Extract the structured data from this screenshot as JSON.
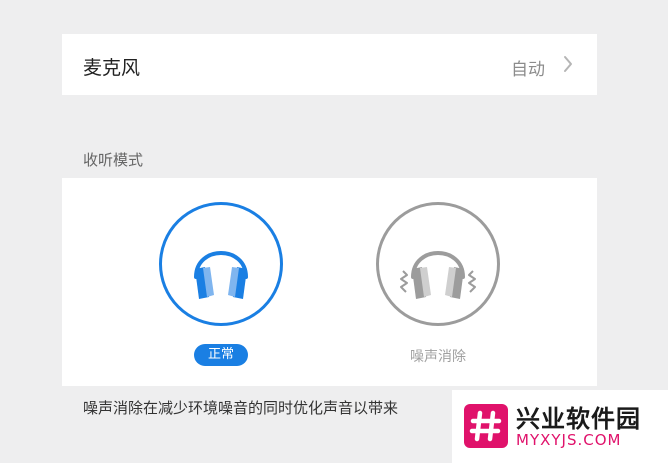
{
  "microphone": {
    "label": "麦克风",
    "value": "自动"
  },
  "listening_mode": {
    "title": "收听模式",
    "options": [
      {
        "label": "正常",
        "selected": true,
        "icon": "headphones-icon"
      },
      {
        "label": "噪声消除",
        "selected": false,
        "icon": "headphones-noise-icon"
      }
    ]
  },
  "description": "噪声消除在减少环境噪音的同时优化声音以带来",
  "watermark": {
    "title": "兴业软件园",
    "url": "MYXYJS.COM"
  },
  "colors": {
    "accent": "#1a7fe3",
    "inactive": "#9c9c9c",
    "watermark": "#e0126b"
  }
}
